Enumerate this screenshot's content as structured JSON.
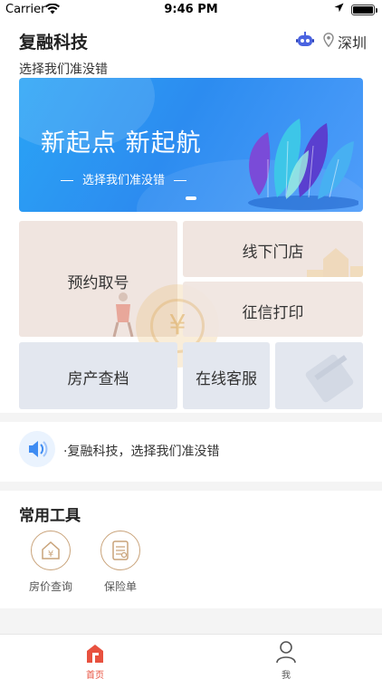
{
  "status_bar": {
    "carrier": "Carrier",
    "time": "9:46 PM"
  },
  "header": {
    "app_title": "复融科技",
    "city": "深圳",
    "slogan": "选择我们准没错"
  },
  "banner": {
    "headline": "新起点 新起航",
    "subline": "选择我们准没错",
    "active_slide": 1,
    "slide_count": 1
  },
  "grid": {
    "book_number": "预约取号",
    "offline_store": "线下门店",
    "credit_print": "征信打印",
    "house_record": "房产查档",
    "online_service": "在线客服"
  },
  "notice": {
    "text": "·复融科技，选择我们准没错"
  },
  "tools": {
    "title": "常用工具",
    "items": [
      {
        "label": "房价查询",
        "icon": "house-price-icon"
      },
      {
        "label": "保险单",
        "icon": "insurance-doc-icon"
      }
    ]
  },
  "tabbar": {
    "home": "首页",
    "me": "我",
    "active": "home"
  },
  "colors": {
    "accent": "#e8513f",
    "banner_blue": "#2c8cf0",
    "tool_gold": "#c9a37a"
  }
}
